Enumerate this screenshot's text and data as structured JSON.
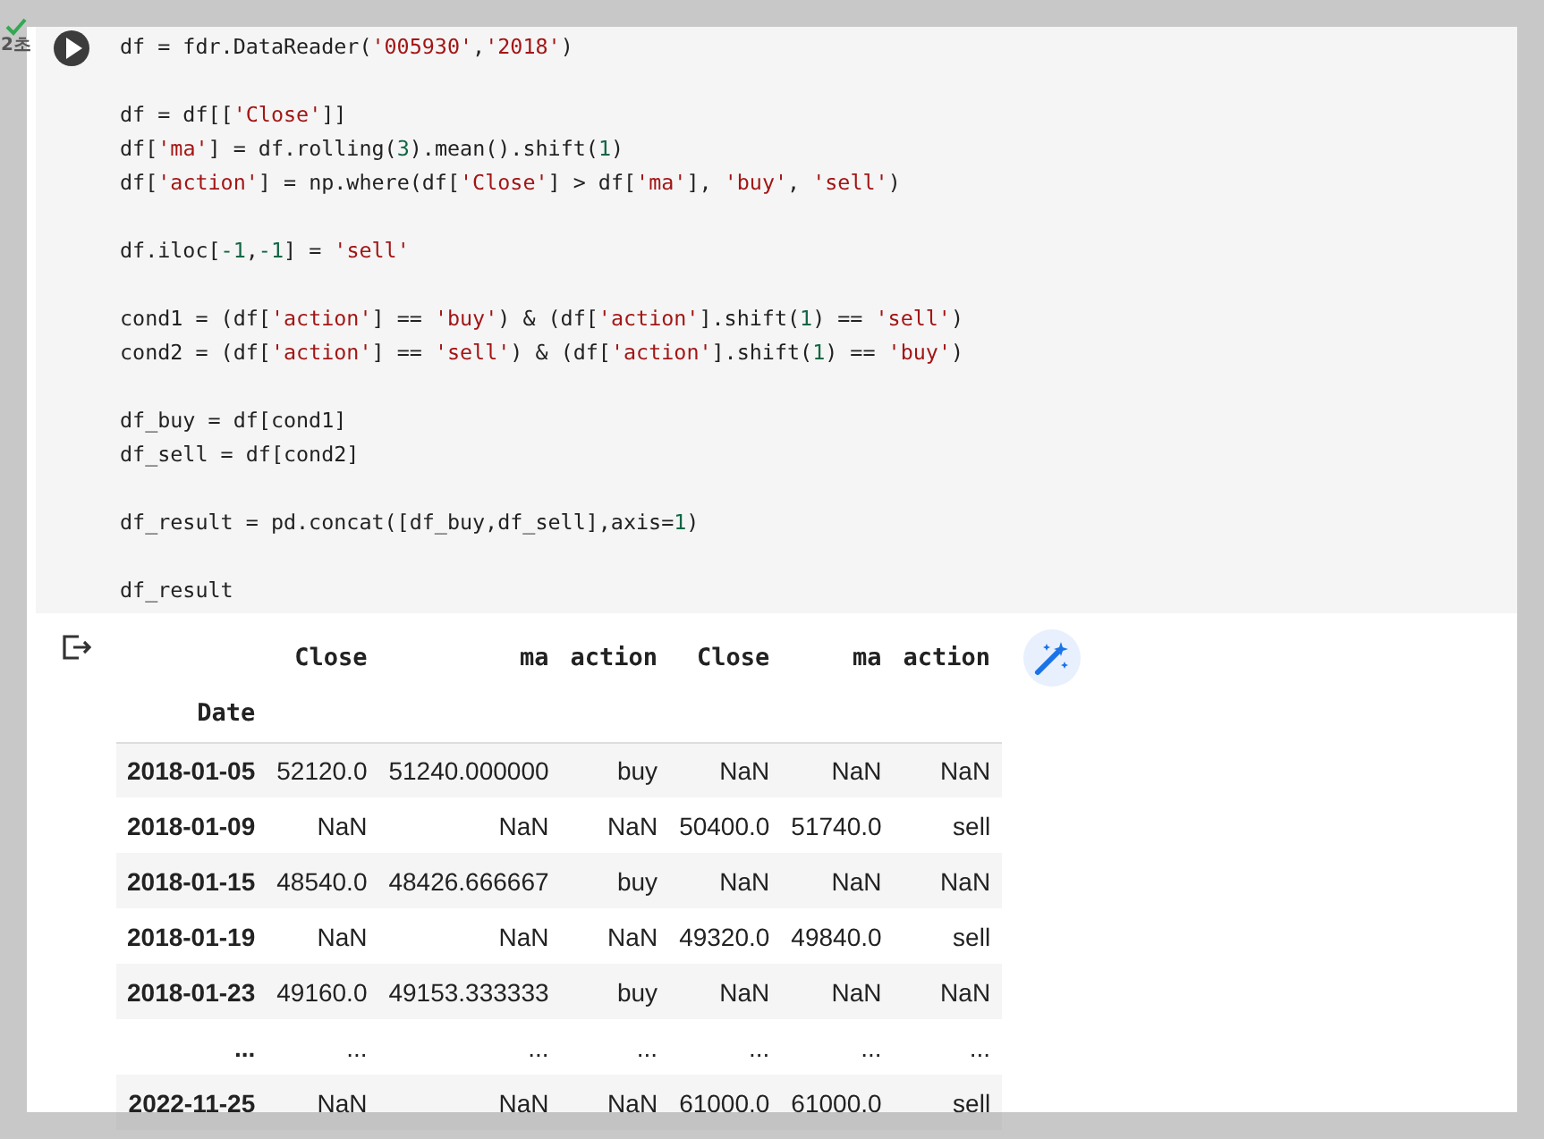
{
  "cell": {
    "run_status": {
      "done": true,
      "time": "2초"
    },
    "code_blocks": [
      [
        [
          {
            "t": "df = fdr.DataReader("
          },
          {
            "t": "'005930'",
            "kind": "string"
          },
          {
            "t": ","
          },
          {
            "t": "'2018'",
            "kind": "string"
          },
          {
            "t": ")"
          }
        ]
      ],
      [
        [
          {
            "t": "df = df[["
          },
          {
            "t": "'Close'",
            "kind": "string"
          },
          {
            "t": "]]"
          }
        ],
        [
          {
            "t": "df["
          },
          {
            "t": "'ma'",
            "kind": "string"
          },
          {
            "t": "] = df.rolling("
          },
          {
            "t": "3",
            "kind": "number"
          },
          {
            "t": ").mean().shift("
          },
          {
            "t": "1",
            "kind": "number"
          },
          {
            "t": ")"
          }
        ],
        [
          {
            "t": "df["
          },
          {
            "t": "'action'",
            "kind": "string"
          },
          {
            "t": "] = np.where(df["
          },
          {
            "t": "'Close'",
            "kind": "string"
          },
          {
            "t": "] > df["
          },
          {
            "t": "'ma'",
            "kind": "string"
          },
          {
            "t": "], "
          },
          {
            "t": "'buy'",
            "kind": "string"
          },
          {
            "t": ", "
          },
          {
            "t": "'sell'",
            "kind": "string"
          },
          {
            "t": ")"
          }
        ]
      ],
      [
        [
          {
            "t": "df.iloc["
          },
          {
            "t": "-1",
            "kind": "number"
          },
          {
            "t": ","
          },
          {
            "t": "-1",
            "kind": "number"
          },
          {
            "t": "] = "
          },
          {
            "t": "'sell'",
            "kind": "string"
          }
        ]
      ],
      [
        [
          {
            "t": "cond1 = (df["
          },
          {
            "t": "'action'",
            "kind": "string"
          },
          {
            "t": "] == "
          },
          {
            "t": "'buy'",
            "kind": "string"
          },
          {
            "t": ") & (df["
          },
          {
            "t": "'action'",
            "kind": "string"
          },
          {
            "t": "].shift("
          },
          {
            "t": "1",
            "kind": "number"
          },
          {
            "t": ") == "
          },
          {
            "t": "'sell'",
            "kind": "string"
          },
          {
            "t": ")"
          }
        ],
        [
          {
            "t": "cond2 = (df["
          },
          {
            "t": "'action'",
            "kind": "string"
          },
          {
            "t": "] == "
          },
          {
            "t": "'sell'",
            "kind": "string"
          },
          {
            "t": ") & (df["
          },
          {
            "t": "'action'",
            "kind": "string"
          },
          {
            "t": "].shift("
          },
          {
            "t": "1",
            "kind": "number"
          },
          {
            "t": ") == "
          },
          {
            "t": "'buy'",
            "kind": "string"
          },
          {
            "t": ")"
          }
        ]
      ],
      [
        [
          {
            "t": "df_buy = df[cond1]"
          }
        ],
        [
          {
            "t": "df_sell = df[cond2]"
          }
        ]
      ],
      [
        [
          {
            "t": "df_result = pd.concat([df_buy,df_sell],axis="
          },
          {
            "t": "1",
            "kind": "number"
          },
          {
            "t": ")"
          }
        ]
      ],
      [
        [
          {
            "t": "df_result"
          }
        ]
      ]
    ],
    "output": {
      "table": {
        "columns": [
          "Close",
          "ma",
          "action",
          "Close",
          "ma",
          "action"
        ],
        "index_name": "Date",
        "rows": [
          {
            "index": "2018-01-05",
            "cells": [
              "52120.0",
              "51240.000000",
              "buy",
              "NaN",
              "NaN",
              "NaN"
            ]
          },
          {
            "index": "2018-01-09",
            "cells": [
              "NaN",
              "NaN",
              "NaN",
              "50400.0",
              "51740.0",
              "sell"
            ]
          },
          {
            "index": "2018-01-15",
            "cells": [
              "48540.0",
              "48426.666667",
              "buy",
              "NaN",
              "NaN",
              "NaN"
            ]
          },
          {
            "index": "2018-01-19",
            "cells": [
              "NaN",
              "NaN",
              "NaN",
              "49320.0",
              "49840.0",
              "sell"
            ]
          },
          {
            "index": "2018-01-23",
            "cells": [
              "49160.0",
              "49153.333333",
              "buy",
              "NaN",
              "NaN",
              "NaN"
            ]
          },
          {
            "index": "...",
            "cells": [
              "...",
              "...",
              "...",
              "...",
              "...",
              "..."
            ]
          },
          {
            "index": "2022-11-25",
            "cells": [
              "NaN",
              "NaN",
              "NaN",
              "61000.0",
              "61000.0",
              "sell"
            ]
          }
        ]
      }
    }
  }
}
